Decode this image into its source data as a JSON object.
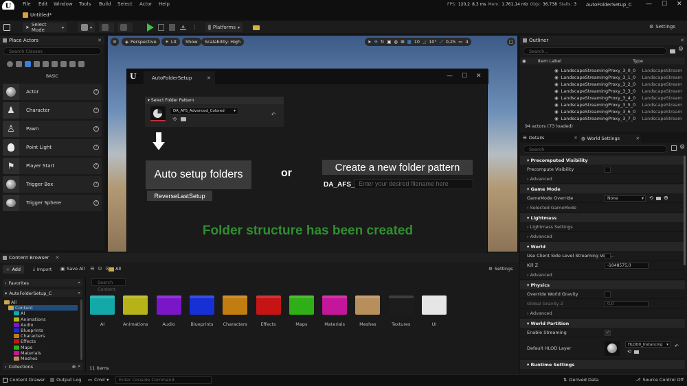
{
  "menu": [
    "File",
    "Edit",
    "Window",
    "Tools",
    "Build",
    "Select",
    "Actor",
    "Help"
  ],
  "stats": {
    "fps_label": "FPS:",
    "fps": "120,2",
    "ms": "8,3 ms",
    "mem_label": "Mem:",
    "mem": "1.761,14 mb",
    "objs_label": "Objs:",
    "objs": "36.738",
    "stalls_label": "Stalls:",
    "stalls": "3",
    "project": "AutoFolderSetup_C"
  },
  "tab": {
    "title": "Untitled*"
  },
  "toolbar": {
    "select_mode": "Select Mode",
    "platforms": "Platforms",
    "settings": "Settings"
  },
  "place_actors": {
    "title": "Place Actors",
    "search_placeholder": "Search Classes",
    "basic": "BASIC",
    "items": [
      {
        "label": "Actor"
      },
      {
        "label": "Character"
      },
      {
        "label": "Pawn"
      },
      {
        "label": "Point Light"
      },
      {
        "label": "Player Start"
      },
      {
        "label": "Trigger Box"
      },
      {
        "label": "Trigger Sphere"
      }
    ]
  },
  "viewport": {
    "perspective": "Perspective",
    "lit": "Lit",
    "show": "Show",
    "scalability": "Scalability: High",
    "grid": "10",
    "angle": "10°",
    "scale": "0,25",
    "cam": "4"
  },
  "dialog": {
    "tab": "AutoFolderSetup",
    "pattern_header": "Select Folder Pattern",
    "pattern_value": "DA_AFS_Advanced_Colored",
    "auto_setup": "Auto setup folders",
    "reverse": "ReverseLastSetup",
    "or": "or",
    "create_pattern": "Create a new folder pattern",
    "prefix": "DA_AFS_",
    "filename_placeholder": "Enter your desired filename here",
    "status": "Folder structure has been created",
    "status_color": "#2f8f2f"
  },
  "outliner": {
    "title": "Outliner",
    "search_placeholder": "Search...",
    "col_label": "Item Label",
    "col_type": "Type",
    "rows": [
      {
        "label": "LandscapeStreamingProxy_3_0_0",
        "type": "LandscapeStream"
      },
      {
        "label": "LandscapeStreamingProxy_3_1_0",
        "type": "LandscapeStream"
      },
      {
        "label": "LandscapeStreamingProxy_3_2_0",
        "type": "LandscapeStream"
      },
      {
        "label": "LandscapeStreamingProxy_3_3_0",
        "type": "LandscapeStream"
      },
      {
        "label": "LandscapeStreamingProxy_3_4_0",
        "type": "LandscapeStream"
      },
      {
        "label": "LandscapeStreamingProxy_3_5_0",
        "type": "LandscapeStream"
      },
      {
        "label": "LandscapeStreamingProxy_3_6_0",
        "type": "LandscapeStream"
      },
      {
        "label": "LandscapeStreamingProxy_3_7_0",
        "type": "LandscapeStream"
      }
    ],
    "count": "94 actors (73 loaded)"
  },
  "details": {
    "tab_details": "Details",
    "tab_world": "World Settings",
    "search_placeholder": "Search",
    "precomputed": "Precomputed Visibility",
    "precompute_vis": "Precompute Visibility",
    "advanced": "Advanced",
    "game_mode": "Game Mode",
    "gm_override": "GameMode Override",
    "gm_value": "None",
    "selected_gm": "Selected GameMode",
    "lightmass": "Lightmass",
    "lightmass_settings": "Lightmass Settings",
    "world": "World",
    "client_streaming": "Use Client Side Level Streaming Volu...",
    "killz": "Kill Z",
    "killz_value": "-1048575,0",
    "physics": "Physics",
    "override_gravity": "Override World Gravity",
    "global_gravity": "Global Gravity Z",
    "gravity_value": "0,0",
    "world_partition": "World Partition",
    "enable_streaming": "Enable Streaming",
    "default_hlod": "Default HLOD Layer",
    "hlod_value": "HLOD0_Instancing",
    "runtime": "Runtime Settings"
  },
  "content_browser": {
    "title": "Content Browser",
    "add": "Add",
    "import": "Import",
    "save_all": "Save All",
    "all": "All",
    "settings": "Settings",
    "favorites": "Favorites",
    "project": "AutoFolderSetup_C",
    "search_placeholder": "Search Content",
    "tree": [
      "All",
      "Content",
      "AI",
      "Animations",
      "Audio",
      "Blueprints",
      "Characters",
      "Effects",
      "Maps",
      "Materials",
      "Meshes"
    ],
    "folders": [
      {
        "name": "AI",
        "color": "#14a9a9"
      },
      {
        "name": "Animations",
        "color": "#b6b318"
      },
      {
        "name": "Audio",
        "color": "#7a16c8"
      },
      {
        "name": "Blueprints",
        "color": "#1630d6"
      },
      {
        "name": "Characters",
        "color": "#c27d10"
      },
      {
        "name": "Effects",
        "color": "#c41414"
      },
      {
        "name": "Maps",
        "color": "#2fae17"
      },
      {
        "name": "Materials",
        "color": "#c4169a"
      },
      {
        "name": "Meshes",
        "color": "#b88f5c"
      },
      {
        "name": "Textures",
        "color": "#1c1c1c"
      },
      {
        "name": "UI",
        "color": "#e6e6e6"
      }
    ],
    "items": "11 items",
    "collections": "Collections"
  },
  "statusbar": {
    "content_drawer": "Content Drawer",
    "output_log": "Output Log",
    "cmd": "Cmd",
    "console_placeholder": "Enter Console Command",
    "derived": "Derived Data",
    "source_control": "Source Control Off"
  }
}
